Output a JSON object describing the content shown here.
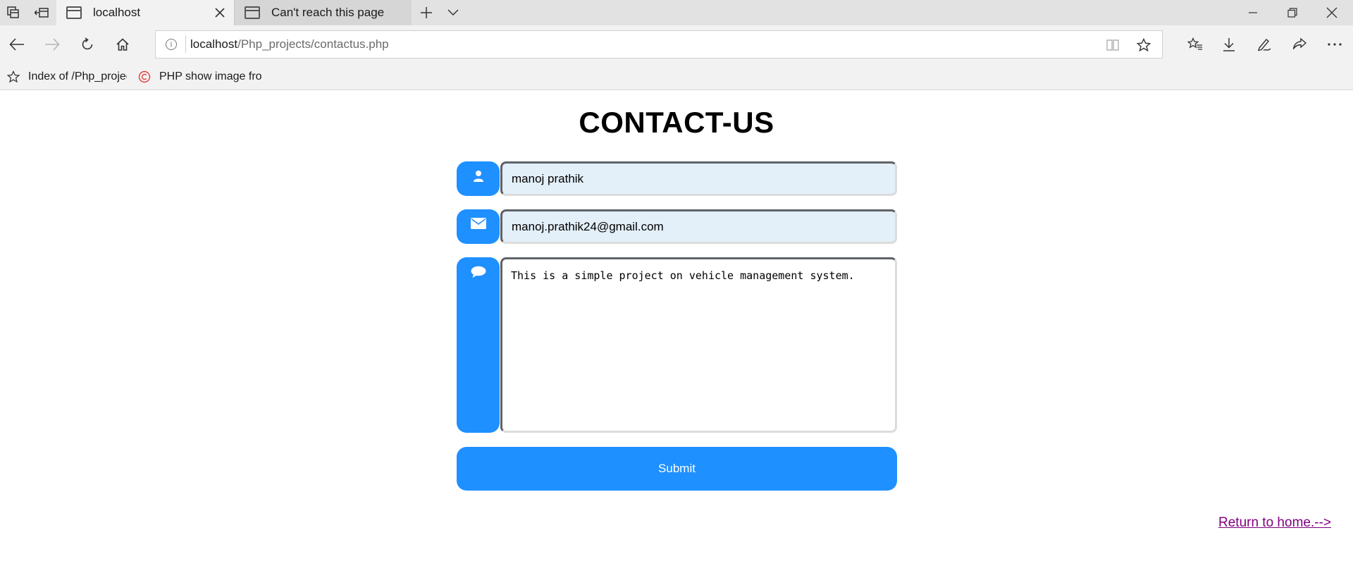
{
  "browser": {
    "tabs": [
      {
        "title": "localhost",
        "active": true
      },
      {
        "title": "Can't reach this page",
        "active": false
      }
    ],
    "address": {
      "host": "localhost",
      "path": "/Php_projects/contactus.php"
    },
    "favorites": [
      {
        "label": "Index of /Php_projec",
        "icon": "star-icon"
      },
      {
        "label": "PHP show image fro",
        "icon": "copyright-icon"
      }
    ]
  },
  "page": {
    "title": "CONTACT-US",
    "form": {
      "name_value": "manoj prathik",
      "email_value": "manoj.prathik24@gmail.com",
      "message_value": "This is a simple project on vehicle management system.",
      "submit_label": "Submit"
    },
    "return_link": "Return to home.-->"
  },
  "colors": {
    "accent": "#1e90ff",
    "input_fill": "#e3eff9",
    "link_visited": "#800080"
  }
}
